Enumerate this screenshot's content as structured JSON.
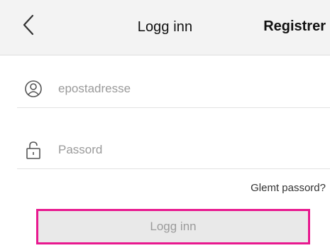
{
  "header": {
    "back_icon": "chevron-left-icon",
    "title": "Logg inn",
    "register_label": "Registrer"
  },
  "form": {
    "email": {
      "icon": "user-circle-icon",
      "placeholder": "epostadresse",
      "value": ""
    },
    "password": {
      "icon": "lock-icon",
      "placeholder": "Passord",
      "value": ""
    },
    "forgot_label": "Glemt passord?",
    "submit_label": "Logg inn"
  },
  "colors": {
    "header_bg": "#f3f3f3",
    "highlight": "#e8188f",
    "button_bg": "#e9e9e9",
    "placeholder": "#9a9a9a"
  }
}
